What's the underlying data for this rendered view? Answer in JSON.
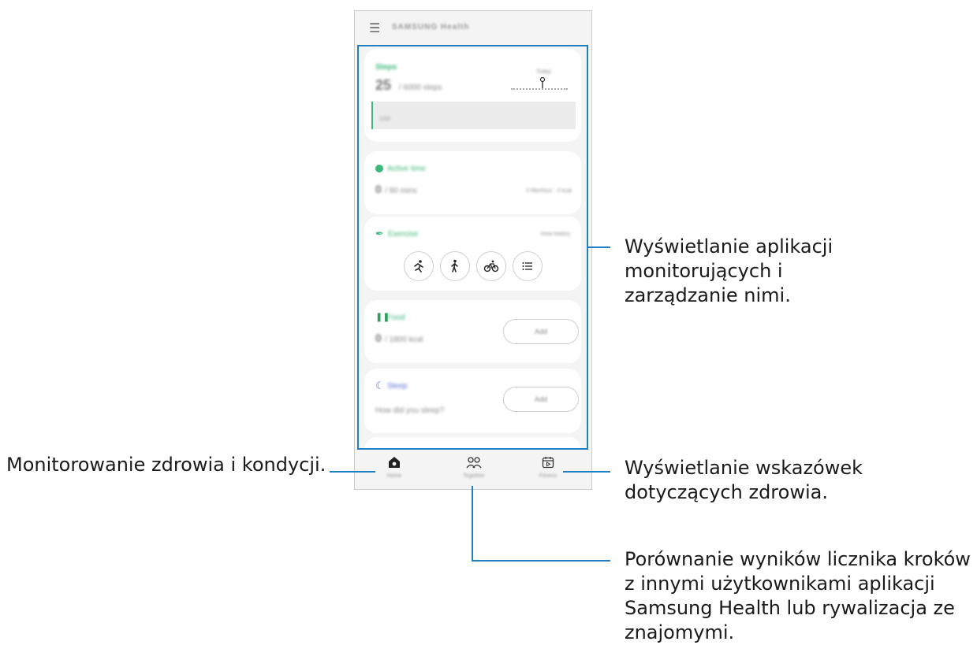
{
  "app": {
    "title": "SAMSUNG Health",
    "menu_icon": "hamburger-icon"
  },
  "cards": {
    "steps": {
      "label": "Steps",
      "count": "25",
      "goal": "/ 6000 steps",
      "badge": "Today",
      "bar_text": "1/10"
    },
    "active_time": {
      "label": "Active time",
      "value": "0",
      "goal": "/ 90 mins",
      "detail": "0 Min/hour · 0 kcal"
    },
    "exercise": {
      "label": "Exercise",
      "link": "View history",
      "types": [
        "running-icon",
        "walking-icon",
        "cycling-icon",
        "list-icon"
      ]
    },
    "food": {
      "label": "Food",
      "value": "0",
      "goal": "/ 1800 kcal",
      "button": "Add"
    },
    "sleep": {
      "label": "Sleep",
      "question": "How did you sleep?",
      "button": "Add"
    }
  },
  "nav": {
    "home": {
      "label": "Home",
      "icon": "home-icon"
    },
    "together": {
      "label": "Together",
      "icon": "people-icon"
    },
    "fitness": {
      "label": "Fitness",
      "icon": "calendar-play-icon"
    }
  },
  "callouts": {
    "trackers": "Wyświetlanie aplikacji monitorujących i zarządzanie nimi.",
    "home": "Monitorowanie zdrowia i kondycji.",
    "tips": "Wyświetlanie wskazówek dotyczących zdrowia.",
    "together": "Porównanie wyników licznika kroków z innymi użytkownikami aplikacji Samsung Health lub rywalizacja ze znajomymi."
  },
  "colors": {
    "accent": "#1f7fc1",
    "green": "#3cb878",
    "sleep": "#5b6fd8",
    "food": "#2e9e58"
  }
}
